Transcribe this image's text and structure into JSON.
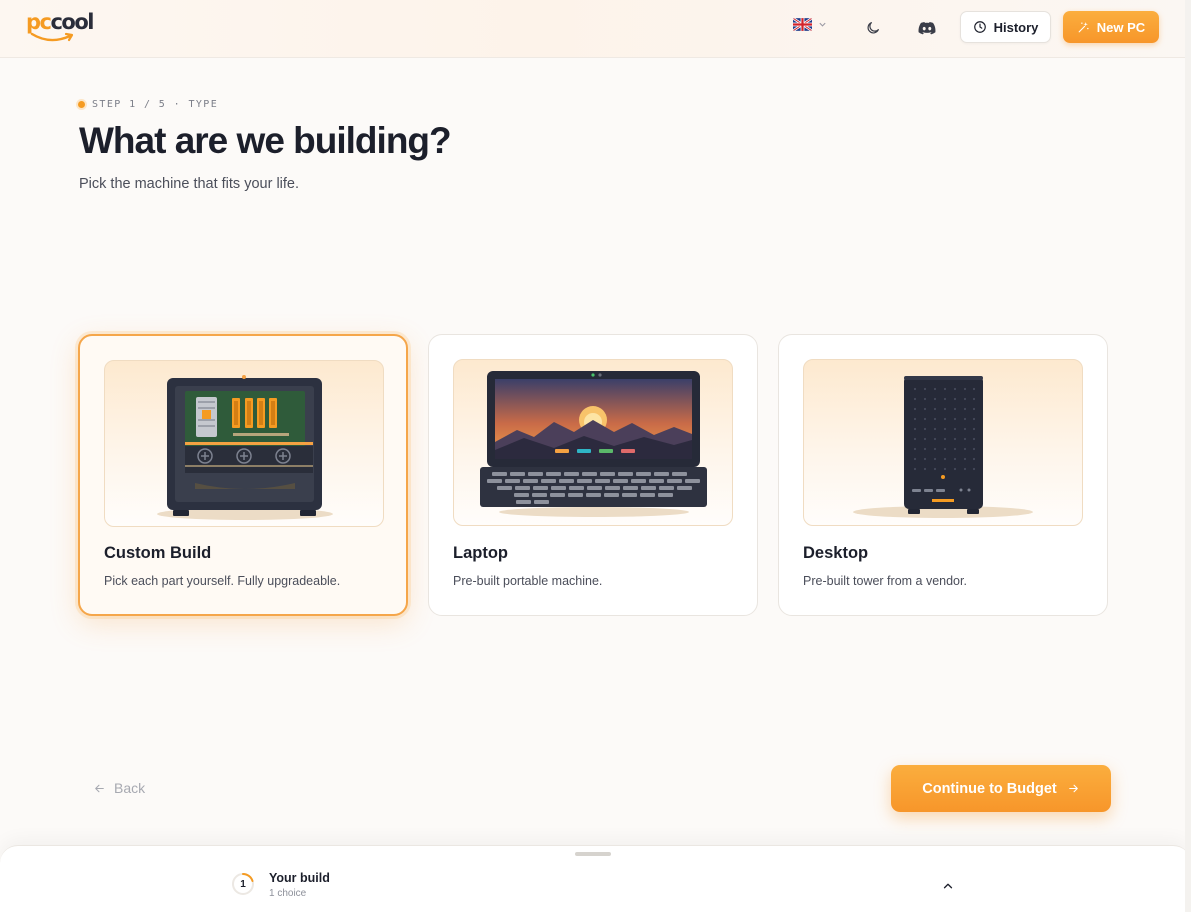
{
  "header": {
    "logo_pc": "pc",
    "logo_cool": "cool",
    "language_icon": "uk-flag-icon",
    "history_label": "History",
    "new_pc_label": "New PC",
    "accent": "#f7962a"
  },
  "step": {
    "label": "STEP 1 / 5 · TYPE",
    "title": "What are we building?",
    "subtitle": "Pick the machine that fits your life."
  },
  "options": [
    {
      "title": "Custom Build",
      "description": "Pick each part yourself. Fully upgradeable.",
      "selected": true,
      "icon": "custom-build-illustration"
    },
    {
      "title": "Laptop",
      "description": "Pre-built portable machine.",
      "selected": false,
      "icon": "laptop-illustration"
    },
    {
      "title": "Desktop",
      "description": "Pre-built tower from a vendor.",
      "selected": false,
      "icon": "desktop-illustration"
    }
  ],
  "nav": {
    "back_label": "Back",
    "continue_label": "Continue to Budget"
  },
  "drawer": {
    "count": "1",
    "title": "Your build",
    "subtitle": "1 choice"
  }
}
